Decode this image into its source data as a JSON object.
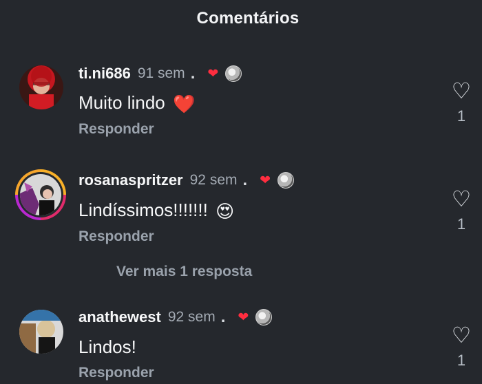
{
  "header": {
    "title": "Comentários"
  },
  "comments": [
    {
      "username": "ti.ni686",
      "time": "91 sem",
      "dot": ".",
      "text": "Muito lindo",
      "reply": "Responder",
      "likes": "1",
      "emoji": "❤️"
    },
    {
      "username": "rosanaspritzer",
      "time": "92 sem",
      "dot": ".",
      "text": "Lindíssimos!!!!!!!",
      "reply": "Responder",
      "likes": "1",
      "emoji": "😍"
    },
    {
      "username": "anathewest",
      "time": "92 sem",
      "dot": ".",
      "text": "Lindos!",
      "reply": "Responder",
      "likes": "1",
      "emoji": ""
    }
  ],
  "more_replies": "Ver mais 1 resposta",
  "colors": {
    "background": "#25282d",
    "heart_accent": "#ff2d3f"
  }
}
